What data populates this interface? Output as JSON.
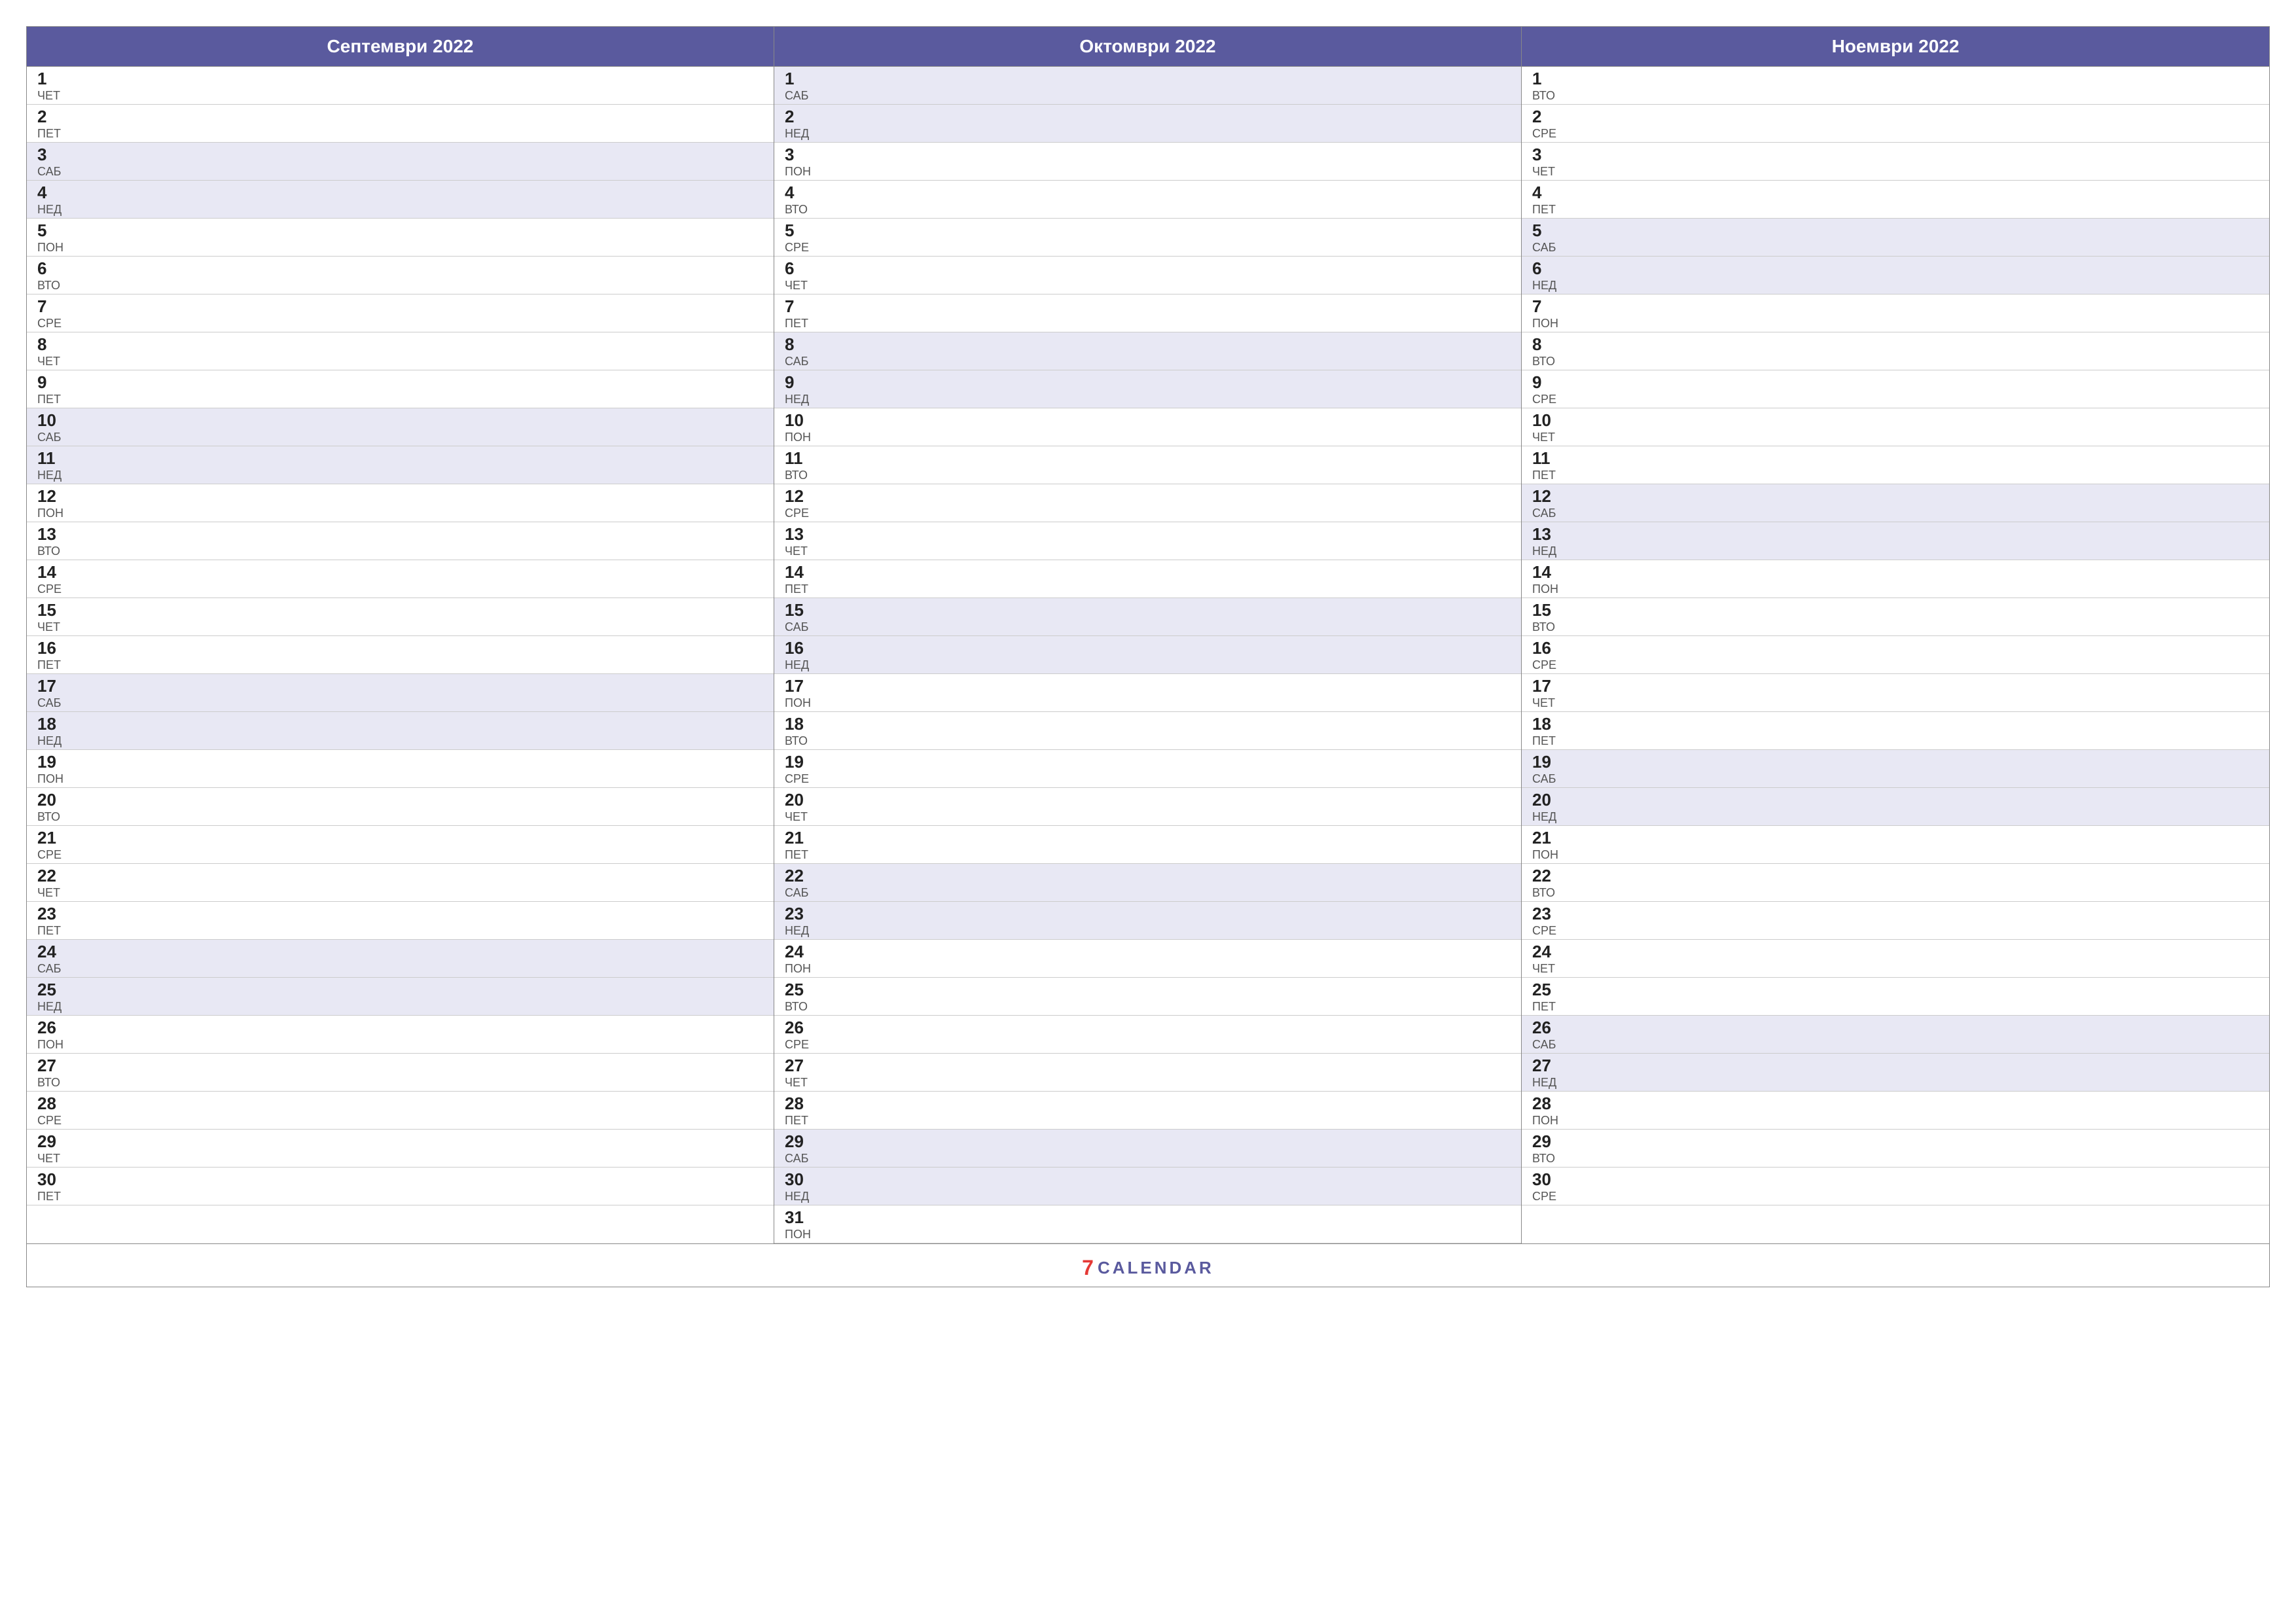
{
  "months": [
    {
      "name": "Септември 2022",
      "days": [
        {
          "num": "1",
          "day": "ЧЕТ",
          "weekend": false
        },
        {
          "num": "2",
          "day": "ПЕТ",
          "weekend": false
        },
        {
          "num": "3",
          "day": "САБ",
          "weekend": true
        },
        {
          "num": "4",
          "day": "НЕД",
          "weekend": true
        },
        {
          "num": "5",
          "day": "ПОН",
          "weekend": false
        },
        {
          "num": "6",
          "day": "ВТО",
          "weekend": false
        },
        {
          "num": "7",
          "day": "СРЕ",
          "weekend": false
        },
        {
          "num": "8",
          "day": "ЧЕТ",
          "weekend": false
        },
        {
          "num": "9",
          "day": "ПЕТ",
          "weekend": false
        },
        {
          "num": "10",
          "day": "САБ",
          "weekend": true
        },
        {
          "num": "11",
          "day": "НЕД",
          "weekend": true
        },
        {
          "num": "12",
          "day": "ПОН",
          "weekend": false
        },
        {
          "num": "13",
          "day": "ВТО",
          "weekend": false
        },
        {
          "num": "14",
          "day": "СРЕ",
          "weekend": false
        },
        {
          "num": "15",
          "day": "ЧЕТ",
          "weekend": false
        },
        {
          "num": "16",
          "day": "ПЕТ",
          "weekend": false
        },
        {
          "num": "17",
          "day": "САБ",
          "weekend": true
        },
        {
          "num": "18",
          "day": "НЕД",
          "weekend": true
        },
        {
          "num": "19",
          "day": "ПОН",
          "weekend": false
        },
        {
          "num": "20",
          "day": "ВТО",
          "weekend": false
        },
        {
          "num": "21",
          "day": "СРЕ",
          "weekend": false
        },
        {
          "num": "22",
          "day": "ЧЕТ",
          "weekend": false
        },
        {
          "num": "23",
          "day": "ПЕТ",
          "weekend": false
        },
        {
          "num": "24",
          "day": "САБ",
          "weekend": true
        },
        {
          "num": "25",
          "day": "НЕД",
          "weekend": true
        },
        {
          "num": "26",
          "day": "ПОН",
          "weekend": false
        },
        {
          "num": "27",
          "day": "ВТО",
          "weekend": false
        },
        {
          "num": "28",
          "day": "СРЕ",
          "weekend": false
        },
        {
          "num": "29",
          "day": "ЧЕТ",
          "weekend": false
        },
        {
          "num": "30",
          "day": "ПЕТ",
          "weekend": false
        }
      ]
    },
    {
      "name": "Октомври 2022",
      "days": [
        {
          "num": "1",
          "day": "САБ",
          "weekend": true
        },
        {
          "num": "2",
          "day": "НЕД",
          "weekend": true
        },
        {
          "num": "3",
          "day": "ПОН",
          "weekend": false
        },
        {
          "num": "4",
          "day": "ВТО",
          "weekend": false
        },
        {
          "num": "5",
          "day": "СРЕ",
          "weekend": false
        },
        {
          "num": "6",
          "day": "ЧЕТ",
          "weekend": false
        },
        {
          "num": "7",
          "day": "ПЕТ",
          "weekend": false
        },
        {
          "num": "8",
          "day": "САБ",
          "weekend": true
        },
        {
          "num": "9",
          "day": "НЕД",
          "weekend": true
        },
        {
          "num": "10",
          "day": "ПОН",
          "weekend": false
        },
        {
          "num": "11",
          "day": "ВТО",
          "weekend": false
        },
        {
          "num": "12",
          "day": "СРЕ",
          "weekend": false
        },
        {
          "num": "13",
          "day": "ЧЕТ",
          "weekend": false
        },
        {
          "num": "14",
          "day": "ПЕТ",
          "weekend": false
        },
        {
          "num": "15",
          "day": "САБ",
          "weekend": true
        },
        {
          "num": "16",
          "day": "НЕД",
          "weekend": true
        },
        {
          "num": "17",
          "day": "ПОН",
          "weekend": false
        },
        {
          "num": "18",
          "day": "ВТО",
          "weekend": false
        },
        {
          "num": "19",
          "day": "СРЕ",
          "weekend": false
        },
        {
          "num": "20",
          "day": "ЧЕТ",
          "weekend": false
        },
        {
          "num": "21",
          "day": "ПЕТ",
          "weekend": false
        },
        {
          "num": "22",
          "day": "САБ",
          "weekend": true
        },
        {
          "num": "23",
          "day": "НЕД",
          "weekend": true
        },
        {
          "num": "24",
          "day": "ПОН",
          "weekend": false
        },
        {
          "num": "25",
          "day": "ВТО",
          "weekend": false
        },
        {
          "num": "26",
          "day": "СРЕ",
          "weekend": false
        },
        {
          "num": "27",
          "day": "ЧЕТ",
          "weekend": false
        },
        {
          "num": "28",
          "day": "ПЕТ",
          "weekend": false
        },
        {
          "num": "29",
          "day": "САБ",
          "weekend": true
        },
        {
          "num": "30",
          "day": "НЕД",
          "weekend": true
        },
        {
          "num": "31",
          "day": "ПОН",
          "weekend": false
        }
      ]
    },
    {
      "name": "Ноември 2022",
      "days": [
        {
          "num": "1",
          "day": "ВТО",
          "weekend": false
        },
        {
          "num": "2",
          "day": "СРЕ",
          "weekend": false
        },
        {
          "num": "3",
          "day": "ЧЕТ",
          "weekend": false
        },
        {
          "num": "4",
          "day": "ПЕТ",
          "weekend": false
        },
        {
          "num": "5",
          "day": "САБ",
          "weekend": true
        },
        {
          "num": "6",
          "day": "НЕД",
          "weekend": true
        },
        {
          "num": "7",
          "day": "ПОН",
          "weekend": false
        },
        {
          "num": "8",
          "day": "ВТО",
          "weekend": false
        },
        {
          "num": "9",
          "day": "СРЕ",
          "weekend": false
        },
        {
          "num": "10",
          "day": "ЧЕТ",
          "weekend": false
        },
        {
          "num": "11",
          "day": "ПЕТ",
          "weekend": false
        },
        {
          "num": "12",
          "day": "САБ",
          "weekend": true
        },
        {
          "num": "13",
          "day": "НЕД",
          "weekend": true
        },
        {
          "num": "14",
          "day": "ПОН",
          "weekend": false
        },
        {
          "num": "15",
          "day": "ВТО",
          "weekend": false
        },
        {
          "num": "16",
          "day": "СРЕ",
          "weekend": false
        },
        {
          "num": "17",
          "day": "ЧЕТ",
          "weekend": false
        },
        {
          "num": "18",
          "day": "ПЕТ",
          "weekend": false
        },
        {
          "num": "19",
          "day": "САБ",
          "weekend": true
        },
        {
          "num": "20",
          "day": "НЕД",
          "weekend": true
        },
        {
          "num": "21",
          "day": "ПОН",
          "weekend": false
        },
        {
          "num": "22",
          "day": "ВТО",
          "weekend": false
        },
        {
          "num": "23",
          "day": "СРЕ",
          "weekend": false
        },
        {
          "num": "24",
          "day": "ЧЕТ",
          "weekend": false
        },
        {
          "num": "25",
          "day": "ПЕТ",
          "weekend": false
        },
        {
          "num": "26",
          "day": "САБ",
          "weekend": true
        },
        {
          "num": "27",
          "day": "НЕД",
          "weekend": true
        },
        {
          "num": "28",
          "day": "ПОН",
          "weekend": false
        },
        {
          "num": "29",
          "day": "ВТО",
          "weekend": false
        },
        {
          "num": "30",
          "day": "СРЕ",
          "weekend": false
        }
      ]
    }
  ],
  "footer": {
    "number": "7",
    "text": "CALENDAR"
  }
}
